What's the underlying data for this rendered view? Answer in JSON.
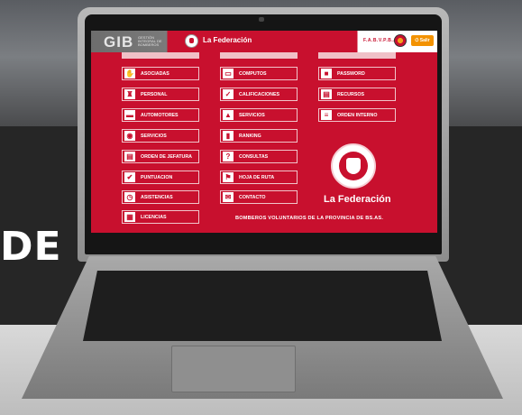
{
  "header": {
    "app_logo": "GIB",
    "app_logo_sub": "GESTIÓN INTEGRAL DE BOMBEROS",
    "brand": "La Federación",
    "org_short": "F.A.B.V.P.B.A.",
    "exit_button": "Salir",
    "exit_icon": "power-icon"
  },
  "menu": {
    "col1": [
      {
        "label": "ASOCIADAS",
        "icon": "handshake-icon"
      },
      {
        "label": "PERSONAL",
        "icon": "firefighter-icon"
      },
      {
        "label": "AUTOMOTORES",
        "icon": "firetruck-icon"
      },
      {
        "label": "SERVICIOS",
        "icon": "siren-icon"
      },
      {
        "label": "ORDEN DE JEFATURA",
        "icon": "document-icon"
      },
      {
        "label": "PUNTUACION",
        "icon": "thumbs-up-icon"
      },
      {
        "label": "ASISTENCIAS",
        "icon": "clock-icon"
      },
      {
        "label": "LICENCIAS",
        "icon": "calendar-icon"
      }
    ],
    "col2": [
      {
        "label": "COMPUTOS",
        "icon": "monitor-icon"
      },
      {
        "label": "CALIFICACIONES",
        "icon": "check-circle-icon"
      },
      {
        "label": "SERVICIOS",
        "icon": "fire-alert-icon"
      },
      {
        "label": "RANKING",
        "icon": "bar-chart-icon"
      },
      {
        "label": "CONSULTAS",
        "icon": "question-icon"
      },
      {
        "label": "HOJA DE RUTA",
        "icon": "route-icon"
      },
      {
        "label": "CONTACTO",
        "icon": "envelope-icon"
      }
    ],
    "col3": [
      {
        "label": "PASSWORD",
        "icon": "lock-icon"
      },
      {
        "label": "RECURSOS",
        "icon": "document-icon"
      },
      {
        "label": "ORDEN INTERNO",
        "icon": "list-icon"
      }
    ]
  },
  "org_name": "La Federación",
  "footer": "BOMBEROS VOLUNTARIOS DE LA PROVINCIA DE BS.AS.",
  "background_text": "DE",
  "colors": {
    "primary": "#c8102e",
    "accent": "#f39200"
  }
}
